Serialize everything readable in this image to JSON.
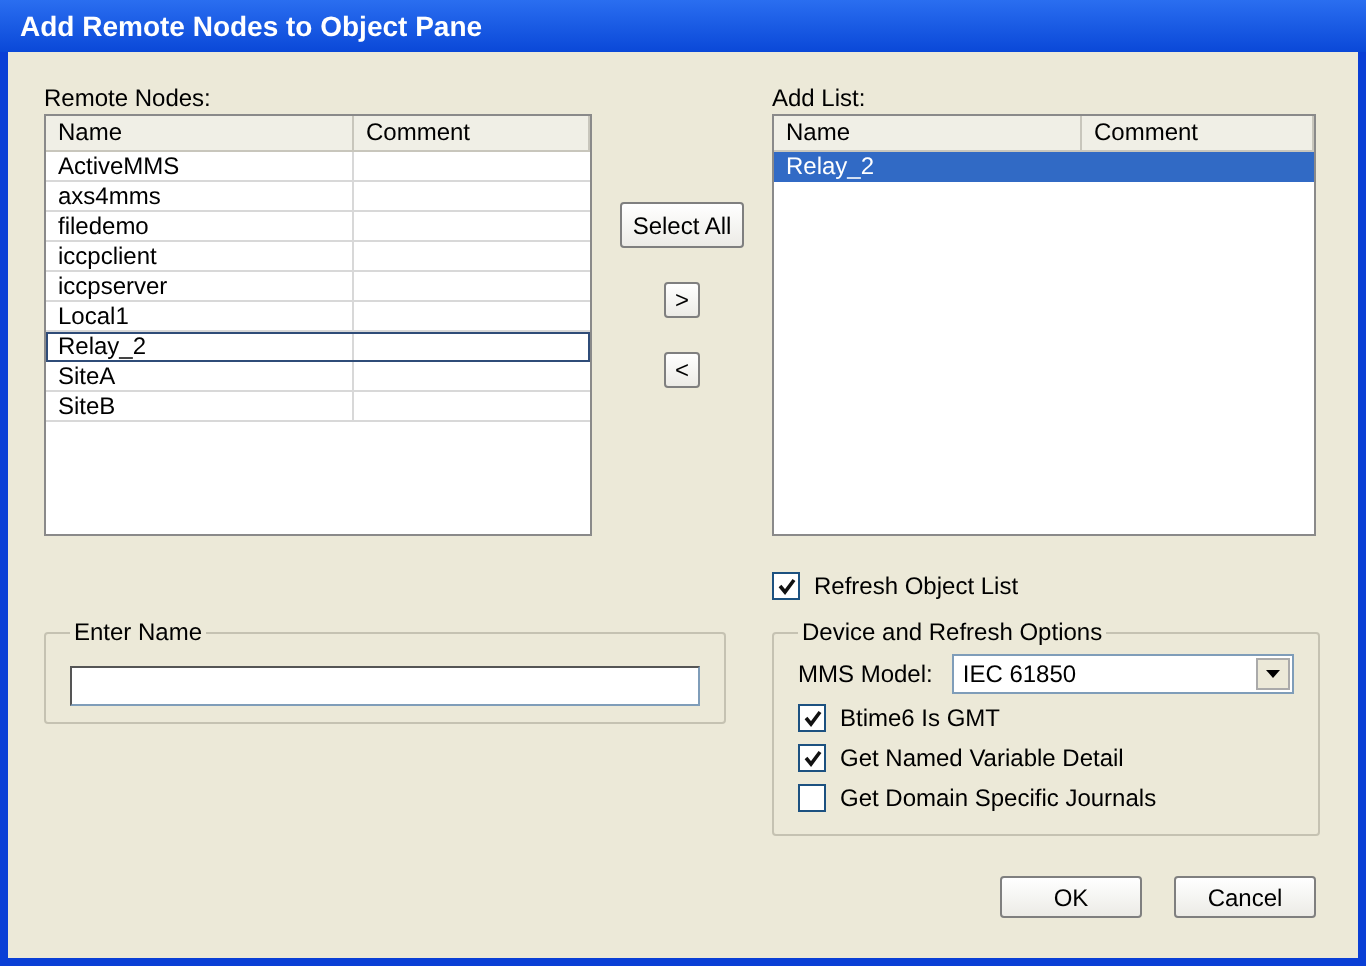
{
  "window": {
    "title": "Add Remote Nodes to Object Pane"
  },
  "remote_nodes": {
    "label": "Remote Nodes:",
    "columns": [
      "Name",
      "Comment"
    ],
    "rows": [
      {
        "name": "ActiveMMS",
        "focused": false
      },
      {
        "name": "axs4mms",
        "focused": false
      },
      {
        "name": "filedemo",
        "focused": false
      },
      {
        "name": "iccpclient",
        "focused": false
      },
      {
        "name": "iccpserver",
        "focused": false
      },
      {
        "name": "Local1",
        "focused": false
      },
      {
        "name": "Relay_2",
        "focused": true
      },
      {
        "name": "SiteA",
        "focused": false
      },
      {
        "name": "SiteB",
        "focused": false
      }
    ]
  },
  "move_buttons": [
    "Select All",
    ">",
    "<"
  ],
  "add_list": {
    "label": "Add List:",
    "columns": [
      "Name",
      "Comment"
    ],
    "rows": [
      {
        "name": "Relay_2",
        "selected": true
      }
    ]
  },
  "refresh_object_list": {
    "label": "Refresh Object List",
    "checked": true
  },
  "enter_name": {
    "label": "Enter Name"
  },
  "device_options": {
    "label": "Device and Refresh Options",
    "mms_model_label": "MMS Model:",
    "mms_model": "IEC 61850",
    "options": [
      {
        "label": "Btime6 Is GMT",
        "checked": true
      },
      {
        "label": "Get Named Variable Detail",
        "checked": true
      },
      {
        "label": "Get Domain Specific Journals",
        "checked": false
      }
    ]
  },
  "buttons": [
    "OK",
    "Cancel"
  ]
}
